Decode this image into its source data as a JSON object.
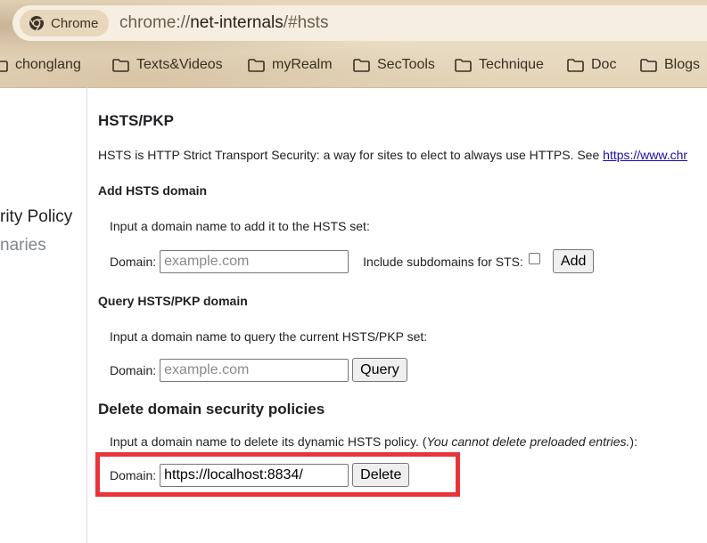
{
  "browser": {
    "chip_label": "Chrome",
    "url_scheme": "chrome://",
    "url_host": "net-internals",
    "url_path": "/#hsts",
    "bookmarks": [
      "chonglang",
      "Texts&Videos",
      "myRealm",
      "SecTools",
      "Technique",
      "Doc",
      "Blogs"
    ]
  },
  "sidebar": {
    "active_item": "rity Policy",
    "next_item": "naries"
  },
  "main": {
    "title": "HSTS/PKP",
    "intro_text": "HSTS is HTTP Strict Transport Security: a way for sites to elect to always use HTTPS. See ",
    "intro_link": "https://www.chr",
    "add": {
      "heading": "Add HSTS domain",
      "description": "Input a domain name to add it to the HSTS set:",
      "domain_label": "Domain:",
      "placeholder": "example.com",
      "include_subdomains_label": "Include subdomains for STS:",
      "button": "Add"
    },
    "query": {
      "heading": "Query HSTS/PKP domain",
      "description": "Input a domain name to query the current HSTS/PKP set:",
      "domain_label": "Domain:",
      "placeholder": "example.com",
      "button": "Query"
    },
    "delete": {
      "heading": "Delete domain security policies",
      "description": "Input a domain name to delete its dynamic HSTS policy. (",
      "description_note": "You cannot delete preloaded entries.",
      "description_end": "):",
      "domain_label": "Domain:",
      "value": "https://localhost:8834/",
      "button": "Delete"
    }
  },
  "colors": {
    "highlight": "#e8343a",
    "link": "#1a0dab"
  }
}
